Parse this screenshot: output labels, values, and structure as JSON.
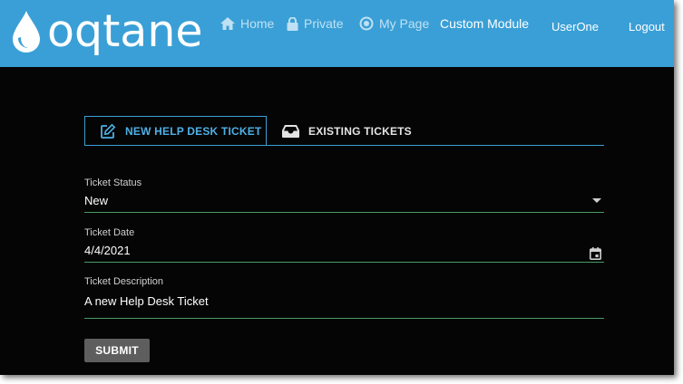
{
  "brand": {
    "logo_text": "oqtane"
  },
  "nav": {
    "home": "Home",
    "private": "Private",
    "my_page": "My Page",
    "custom_module": "Custom Module"
  },
  "user": {
    "name": "UserOne",
    "logout": "Logout"
  },
  "tabs": [
    {
      "label": "NEW HELP DESK TICKET",
      "icon": "edit-icon",
      "active": true
    },
    {
      "label": "EXISTING TICKETS",
      "icon": "inbox-icon",
      "active": false
    }
  ],
  "form": {
    "status": {
      "label": "Ticket Status",
      "value": "New"
    },
    "date": {
      "label": "Ticket Date",
      "value": "4/4/2021"
    },
    "description": {
      "label": "Ticket Description",
      "value": "A new Help Desk Ticket"
    },
    "submit_label": "SUBMIT"
  },
  "colors": {
    "topbar": "#3a9fd6",
    "background": "#050505",
    "active_tab": "#4fb0e6",
    "field_underline": "#4a9b61",
    "submit_button": "#5e5e5e"
  }
}
